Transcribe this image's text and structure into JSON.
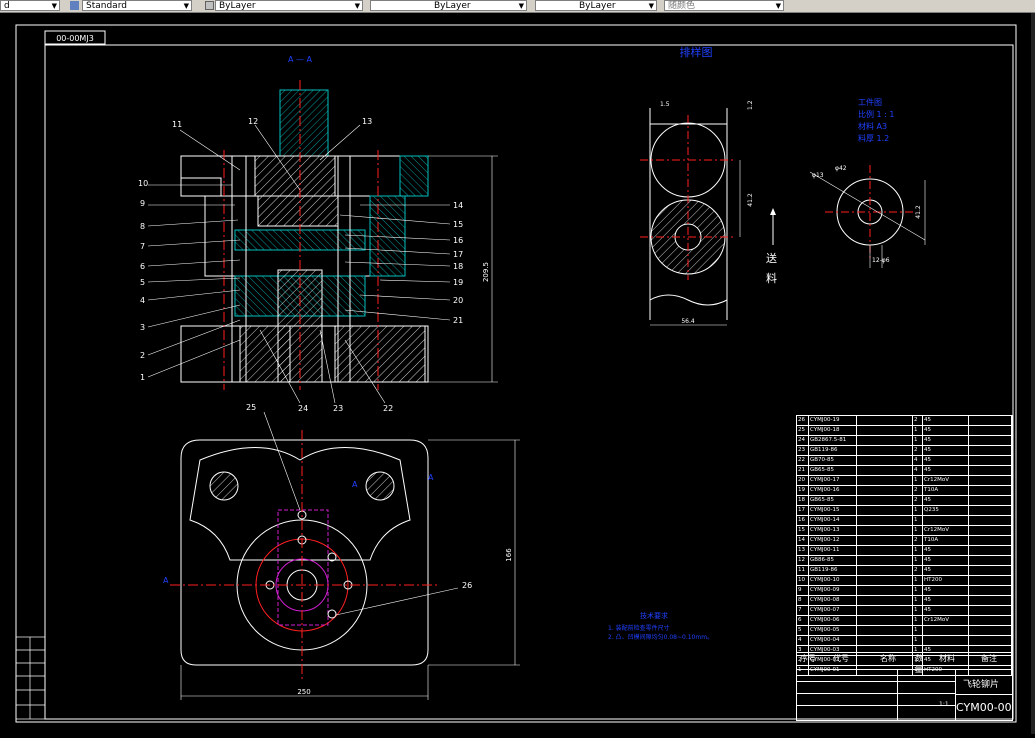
{
  "toolbar": {
    "combo1": "d",
    "combo2": "Standard",
    "combo3": "ByLayer",
    "combo4": "ByLayer",
    "combo5": "ByLayer",
    "combo6": "随颜色"
  },
  "drawing": {
    "drawing_no_box": "00-00MJ3",
    "section_label": "A — A",
    "strip_title": "排样图",
    "feed_label_1": "送",
    "feed_label_2": "料",
    "strip_dim_top": "1.5",
    "strip_dim_right_top": "1.2",
    "strip_dim_side": "41.2",
    "strip_dim_bottom": "56.4",
    "workpiece_title": "工件图",
    "workpiece_scale": "比例 1 : 1",
    "workpiece_material": "材料 A3",
    "workpiece_thickness": "料厚 1.2",
    "wp_dim_1": "φ13",
    "wp_dim_2": "φ42",
    "wp_dim_3": "41.2",
    "wp_dim_4": "12-φ6",
    "height_dim": "209.5",
    "plan_dim_right": "166",
    "plan_dim_bottom": "250",
    "tech_title": "技术要求",
    "tech_line_1": "1. 装配前检查零件尺寸",
    "tech_line_2": "2. 凸、凹模间隙均匀0.08~0.10mm。",
    "plan_label_26": "26",
    "plan_label_25": "25",
    "a_label": "A",
    "callouts_left": [
      "11",
      "10",
      "9",
      "8",
      "7",
      "6",
      "5",
      "4",
      "3",
      "2",
      "1"
    ],
    "callouts_top": [
      "12",
      "13"
    ],
    "callouts_right": [
      "14",
      "15",
      "16",
      "17",
      "18",
      "19",
      "20",
      "21"
    ],
    "callouts_bottom": [
      "24",
      "23",
      "22"
    ]
  },
  "bom": {
    "rows": [
      [
        "26",
        "CYMJ00-19",
        "",
        "2",
        "45",
        ""
      ],
      [
        "25",
        "CYMJ00-18",
        "",
        "1",
        "45",
        ""
      ],
      [
        "24",
        "GB2867.5-81",
        "",
        "1",
        "45",
        ""
      ],
      [
        "23",
        "GB119-86",
        "",
        "2",
        "45",
        ""
      ],
      [
        "22",
        "GB70-85",
        "",
        "4",
        "45",
        ""
      ],
      [
        "21",
        "GB65-85",
        "",
        "4",
        "45",
        ""
      ],
      [
        "20",
        "CYMJ00-17",
        "",
        "1",
        "Cr12MoV",
        ""
      ],
      [
        "19",
        "CYMJ00-16",
        "",
        "2",
        "T10A",
        ""
      ],
      [
        "18",
        "GB65-85",
        "",
        "2",
        "45",
        ""
      ],
      [
        "17",
        "CYMJ00-15",
        "",
        "1",
        "Q235",
        ""
      ],
      [
        "16",
        "CYMJ00-14",
        "",
        "1",
        "",
        ""
      ],
      [
        "15",
        "CYMJ00-13",
        "",
        "1",
        "Cr12MoV",
        ""
      ],
      [
        "14",
        "CYMJ00-12",
        "",
        "2",
        "T10A",
        ""
      ],
      [
        "13",
        "CYMJ00-11",
        "",
        "1",
        "45",
        ""
      ],
      [
        "12",
        "GB86-85",
        "",
        "1",
        "45",
        ""
      ],
      [
        "11",
        "GB119-86",
        "",
        "2",
        "45",
        ""
      ],
      [
        "10",
        "CYMJ00-10",
        "",
        "1",
        "HT200",
        ""
      ],
      [
        "9",
        "CYMJ00-09",
        "",
        "1",
        "45",
        ""
      ],
      [
        "8",
        "CYMJ00-08",
        "",
        "1",
        "45",
        ""
      ],
      [
        "7",
        "CYMJ00-07",
        "",
        "1",
        "45",
        ""
      ],
      [
        "6",
        "CYMJ00-06",
        "",
        "1",
        "Cr12MoV",
        ""
      ],
      [
        "5",
        "CYMJ00-05",
        "",
        "1",
        "",
        ""
      ],
      [
        "4",
        "CYMJ00-04",
        "",
        "1",
        "",
        ""
      ],
      [
        "3",
        "CYMJ00-03",
        "",
        "1",
        "45",
        ""
      ],
      [
        "2",
        "CYMJ00-02",
        "",
        "1",
        "45",
        ""
      ],
      [
        "1",
        "CYMJ00-01",
        "",
        "1",
        "HT200",
        ""
      ]
    ],
    "header": [
      "序号",
      "代号",
      "名称",
      "数量",
      "材料",
      "备注"
    ],
    "title_name": "飞轮铆片",
    "drawing_code": "CYM00-00",
    "scale": "1:1"
  },
  "colors": {
    "line": "#ffffff",
    "center": "#ff2020",
    "hatch": "#00c0c0",
    "blue": "#2040ff",
    "magenta": "#d020d0",
    "yellow": "#ffff00",
    "background": "#000000"
  }
}
